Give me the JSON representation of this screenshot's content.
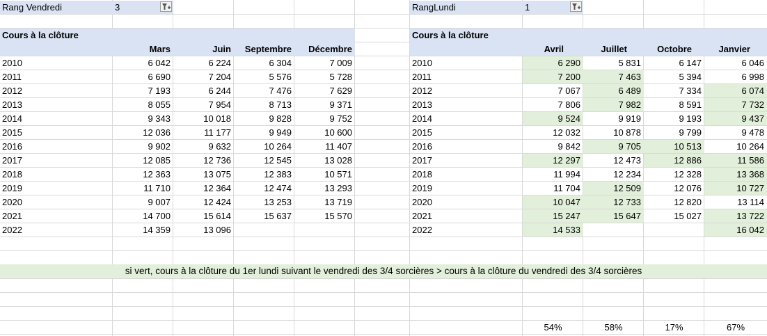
{
  "left_filter": {
    "label": "Rang Vendredi",
    "value": "3"
  },
  "right_filter": {
    "label": "RangLundi",
    "value": "1"
  },
  "left_table": {
    "title": "Cours à la clôture",
    "columns": [
      "Mars",
      "Juin",
      "Septembre",
      "Décembre"
    ],
    "rows": [
      {
        "year": "2010",
        "values": [
          "6 042",
          "6 224",
          "6 304",
          "7 009"
        ]
      },
      {
        "year": "2011",
        "values": [
          "6 690",
          "7 204",
          "5 576",
          "5 728"
        ]
      },
      {
        "year": "2012",
        "values": [
          "7 193",
          "6 244",
          "7 476",
          "7 629"
        ]
      },
      {
        "year": "2013",
        "values": [
          "8 055",
          "7 954",
          "8 713",
          "9 371"
        ]
      },
      {
        "year": "2014",
        "values": [
          "9 343",
          "10 018",
          "9 828",
          "9 752"
        ]
      },
      {
        "year": "2015",
        "values": [
          "12 036",
          "11 177",
          "9 949",
          "10 600"
        ]
      },
      {
        "year": "2016",
        "values": [
          "9 902",
          "9 632",
          "10 264",
          "11 407"
        ]
      },
      {
        "year": "2017",
        "values": [
          "12 085",
          "12 736",
          "12 545",
          "13 028"
        ]
      },
      {
        "year": "2018",
        "values": [
          "12 363",
          "13 075",
          "12 383",
          "10 571"
        ]
      },
      {
        "year": "2019",
        "values": [
          "11 710",
          "12 364",
          "12 474",
          "13 293"
        ]
      },
      {
        "year": "2020",
        "values": [
          "9 007",
          "12 424",
          "13 253",
          "13 719"
        ]
      },
      {
        "year": "2021",
        "values": [
          "14 700",
          "15 614",
          "15 637",
          "15 570"
        ]
      },
      {
        "year": "2022",
        "values": [
          "14 359",
          "13 096",
          "",
          ""
        ]
      }
    ]
  },
  "right_table": {
    "title": "Cours à la clôture",
    "columns": [
      "Avril",
      "Juillet",
      "Octobre",
      "Janvier"
    ],
    "rows": [
      {
        "year": "2010",
        "values": [
          "6 290",
          "5 831",
          "6 147",
          "6 046"
        ],
        "green": [
          true,
          false,
          false,
          false
        ]
      },
      {
        "year": "2011",
        "values": [
          "7 200",
          "7 463",
          "5 394",
          "6 998"
        ],
        "green": [
          true,
          true,
          false,
          false
        ]
      },
      {
        "year": "2012",
        "values": [
          "7 067",
          "6 489",
          "7 334",
          "6 074"
        ],
        "green": [
          false,
          true,
          false,
          true
        ]
      },
      {
        "year": "2013",
        "values": [
          "7 806",
          "7 982",
          "8 591",
          "7 732"
        ],
        "green": [
          false,
          true,
          false,
          true
        ]
      },
      {
        "year": "2014",
        "values": [
          "9 524",
          "9 919",
          "9 193",
          "9 437"
        ],
        "green": [
          true,
          false,
          false,
          true
        ]
      },
      {
        "year": "2015",
        "values": [
          "12 032",
          "10 878",
          "9 799",
          "9 478"
        ],
        "green": [
          false,
          false,
          false,
          false
        ]
      },
      {
        "year": "2016",
        "values": [
          "9 842",
          "9 705",
          "10 513",
          "10 264"
        ],
        "green": [
          false,
          true,
          true,
          false
        ]
      },
      {
        "year": "2017",
        "values": [
          "12 297",
          "12 473",
          "12 886",
          "11 586"
        ],
        "green": [
          true,
          false,
          true,
          true
        ]
      },
      {
        "year": "2018",
        "values": [
          "11 994",
          "12 234",
          "12 328",
          "13 368"
        ],
        "green": [
          false,
          false,
          false,
          true
        ]
      },
      {
        "year": "2019",
        "values": [
          "11 704",
          "12 509",
          "12 076",
          "10 727"
        ],
        "green": [
          false,
          true,
          false,
          true
        ]
      },
      {
        "year": "2020",
        "values": [
          "10 047",
          "12 733",
          "12 820",
          "13 114"
        ],
        "green": [
          true,
          true,
          false,
          false
        ]
      },
      {
        "year": "2021",
        "values": [
          "15 247",
          "15 647",
          "15 027",
          "13 722"
        ],
        "green": [
          true,
          true,
          false,
          true
        ]
      },
      {
        "year": "2022",
        "values": [
          "14 533",
          "",
          "",
          "16 042"
        ],
        "green": [
          true,
          false,
          false,
          true
        ]
      }
    ]
  },
  "note": "si vert, cours à la clôture du 1er lundi suivant le vendredi des 3/4 sorcières > cours à la clôture du vendredi des 3/4 sorcières",
  "percentages": [
    "54%",
    "58%",
    "17%",
    "67%"
  ],
  "colors": {
    "header_band": "#dae3f3",
    "green_fill": "#e2efda",
    "gridline": "#d9d9d9"
  }
}
